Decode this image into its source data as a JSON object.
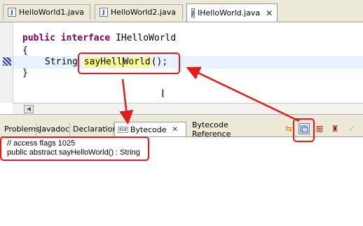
{
  "editor_tabs": [
    {
      "label": "HelloWorld1.java"
    },
    {
      "label": "HelloWorld2.java"
    },
    {
      "label": "IHelloWorld.java",
      "active": true
    }
  ],
  "code": {
    "kw_public": "public",
    "kw_interface": "interface",
    "class_name": "IHelloWorld",
    "open_brace": "{",
    "type": "String",
    "method_a": "sayHell",
    "method_b": "World",
    "method_tail": "();",
    "close_brace": "}"
  },
  "view_tabs": [
    {
      "label": "Problems"
    },
    {
      "label": "Javadoc"
    },
    {
      "label": "Declaration"
    },
    {
      "label": "Bytecode",
      "active": true,
      "icon_text": "010"
    },
    {
      "label": "Bytecode Reference"
    }
  ],
  "bytecode_lines": [
    "// access flags 1025",
    "public abstract sayHelloWorld() : String"
  ],
  "colors": {
    "annotation": "#e21b1b",
    "keyword": "#7f0055",
    "chrome": "#ece9d8"
  }
}
